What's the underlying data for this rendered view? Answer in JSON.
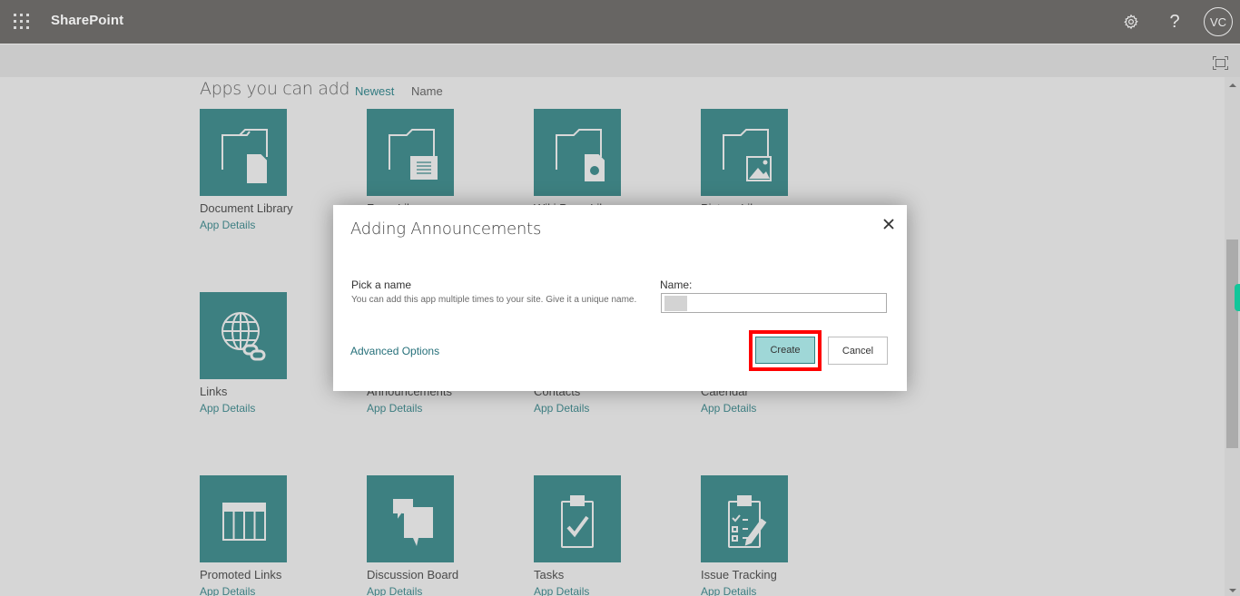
{
  "suitebar": {
    "app_name": "SharePoint",
    "waffle_icon": "app-launcher-icon",
    "settings_icon": "gear-icon",
    "help_icon": "question-icon",
    "help_glyph": "?",
    "avatar_initials": "VC"
  },
  "commandbar": {
    "focus_icon": "focus-mode-icon"
  },
  "content": {
    "heading": "Apps you can add",
    "sort_options": [
      "Newest",
      "Name"
    ],
    "active_sort": "Newest",
    "details_label": "App Details",
    "tiles": [
      {
        "title": "Document Library",
        "icon": "document-library-icon"
      },
      {
        "title": "Form Library",
        "icon": "form-library-icon"
      },
      {
        "title": "Wiki Page Library",
        "icon": "wiki-library-icon"
      },
      {
        "title": "Picture Library",
        "icon": "picture-library-icon"
      },
      {
        "title": "Links",
        "icon": "links-globe-icon"
      },
      {
        "title": "Announcements",
        "icon": "announcements-icon"
      },
      {
        "title": "Contacts",
        "icon": "contacts-icon"
      },
      {
        "title": "Calendar",
        "icon": "calendar-icon"
      },
      {
        "title": "Promoted Links",
        "icon": "promoted-links-icon"
      },
      {
        "title": "Discussion Board",
        "icon": "discussion-board-icon"
      },
      {
        "title": "Tasks",
        "icon": "tasks-clipboard-icon"
      },
      {
        "title": "Issue Tracking",
        "icon": "issue-tracking-icon"
      }
    ]
  },
  "dialog": {
    "title": "Adding Announcements",
    "close_icon": "close-icon",
    "pick_label": "Pick a name",
    "pick_description": "You can add this app multiple times to your site. Give it a unique name.",
    "name_label": "Name:",
    "name_value": "",
    "advanced_link": "Advanced Options",
    "create_label": "Create",
    "cancel_label": "Cancel",
    "highlight_color": "#ff0000"
  },
  "colors": {
    "suitebar": "#676563",
    "tile": "#3d8081",
    "link": "#327b81",
    "create_button": "#9fd7d7",
    "side_tab": "#12c69a"
  }
}
